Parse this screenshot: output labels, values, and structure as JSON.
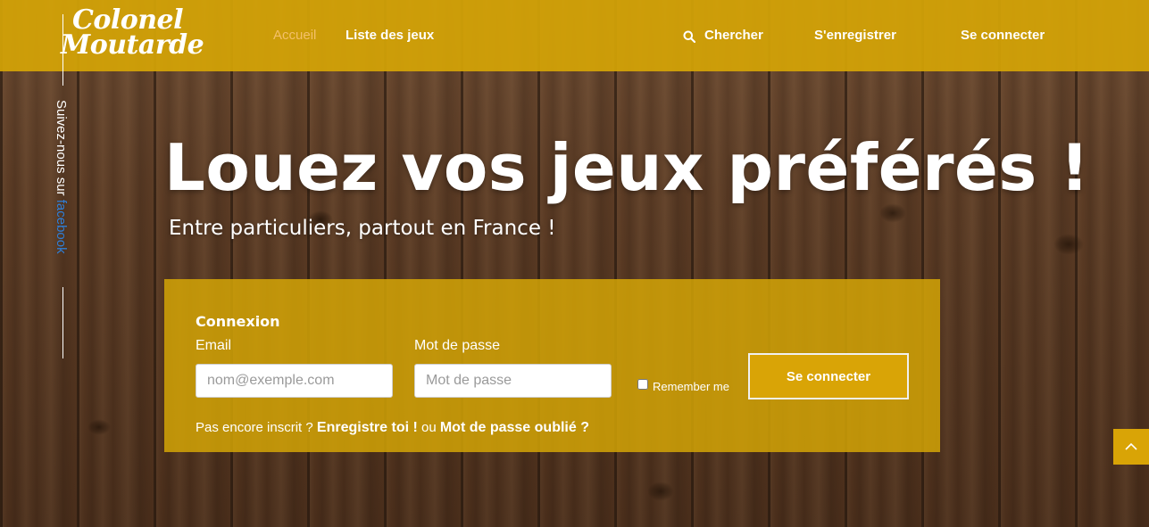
{
  "brand": {
    "line1": "Colonel",
    "line2": "Moutarde"
  },
  "nav": {
    "home": "Accueil",
    "games": "Liste des jeux",
    "search": "Chercher",
    "register": "S'enregistrer",
    "login": "Se connecter"
  },
  "side": {
    "prefix": "Suivez-nous sur ",
    "network": "facebook"
  },
  "hero": {
    "title": "Louez vos jeux préférés !",
    "subtitle": "Entre particuliers, partout en France !"
  },
  "login_form": {
    "title": "Connexion",
    "email_label": "Email",
    "email_placeholder": "nom@exemple.com",
    "password_label": "Mot de passe",
    "password_placeholder": "Mot de passe",
    "remember_label": "Remember me",
    "submit_label": "Se connecter",
    "footer_prefix": "Pas encore inscrit ? ",
    "register_link": "Enregistre toi !",
    "footer_or": " ou ",
    "forgot_link": "Mot de passe oublié ?"
  },
  "colors": {
    "accent": "#d4a406",
    "active_link": "#f4c06a",
    "facebook": "#2f7fd8"
  },
  "icons": {
    "search": "search-icon",
    "back_to_top": "chevron-up-icon"
  }
}
